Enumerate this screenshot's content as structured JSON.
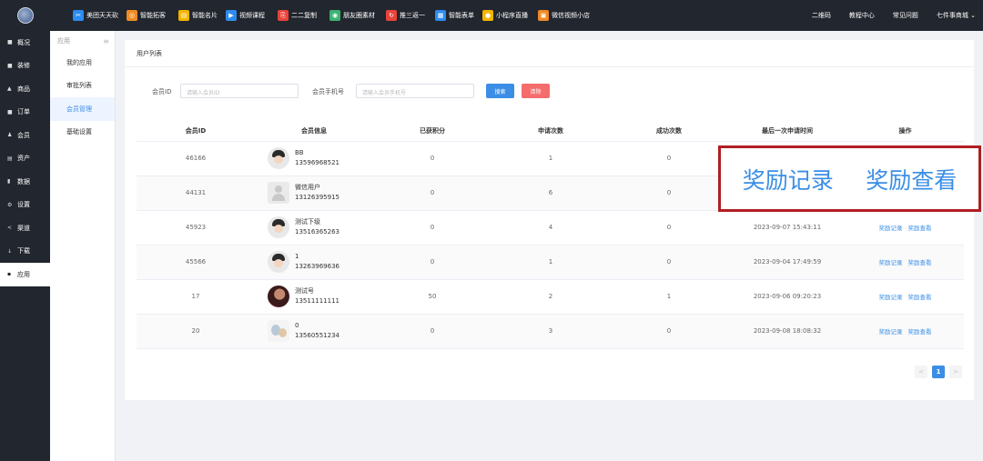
{
  "topnav": {
    "items": [
      {
        "label": "美团天天砍",
        "color": "#2d8cf0",
        "icon": "scissors-icon",
        "glyph": "✂"
      },
      {
        "label": "智能拓客",
        "color": "#f08a24",
        "icon": "target-icon",
        "glyph": "◎"
      },
      {
        "label": "智能名片",
        "color": "#f5b400",
        "icon": "card-icon",
        "glyph": "▤"
      },
      {
        "label": "视频课程",
        "color": "#2d8cf0",
        "icon": "video-icon",
        "glyph": "▶"
      },
      {
        "label": "二二复制",
        "color": "#e8433a",
        "icon": "copy-icon",
        "glyph": "⎘"
      },
      {
        "label": "朋友圈素材",
        "color": "#3cb371",
        "icon": "moments-icon",
        "glyph": "◉"
      },
      {
        "label": "推三返一",
        "color": "#e8433a",
        "icon": "share-icon",
        "glyph": "↻"
      },
      {
        "label": "智能表单",
        "color": "#2d8cf0",
        "icon": "form-icon",
        "glyph": "▦"
      },
      {
        "label": "小程序直播",
        "color": "#f5b400",
        "icon": "live-icon",
        "glyph": "●"
      },
      {
        "label": "微信视频小店",
        "color": "#f08a24",
        "icon": "shop-icon",
        "glyph": "▣"
      }
    ],
    "right": [
      "二维码",
      "教程中心",
      "常见问题",
      "七件事商城 ⌄"
    ]
  },
  "leftnav": [
    {
      "label": "概况",
      "glyph": "■"
    },
    {
      "label": "装修",
      "glyph": "■"
    },
    {
      "label": "商品",
      "glyph": "▲"
    },
    {
      "label": "订单",
      "glyph": "■"
    },
    {
      "label": "会员",
      "glyph": "♟"
    },
    {
      "label": "资产",
      "glyph": "▤"
    },
    {
      "label": "数据",
      "glyph": "▮"
    },
    {
      "label": "设置",
      "glyph": "⚙"
    },
    {
      "label": "渠道",
      "glyph": "<"
    },
    {
      "label": "下载",
      "glyph": "↓"
    },
    {
      "label": "应用",
      "glyph": "▪"
    }
  ],
  "subnav": {
    "header": "应用",
    "items": [
      "我的应用",
      "审批列表",
      "会员管理",
      "基础设置"
    ]
  },
  "panel": {
    "title": "用户列表"
  },
  "filters": {
    "member_id_label": "会员ID",
    "member_id_placeholder": "请输入会员ID",
    "phone_label": "会员手机号",
    "phone_placeholder": "请输入会员手机号",
    "search_label": "搜索",
    "clear_label": "清除"
  },
  "table": {
    "headers": [
      "会员ID",
      "会员信息",
      "已获积分",
      "申请次数",
      "成功次数",
      "最后一次申请时间",
      "操作"
    ],
    "rows": [
      {
        "id": "46166",
        "name": "BB",
        "phone": "13596968521",
        "points": "0",
        "applies": "1",
        "success": "0",
        "last": "",
        "avatar": "face"
      },
      {
        "id": "44131",
        "name": "微信用户",
        "phone": "13126395915",
        "points": "0",
        "applies": "6",
        "success": "0",
        "last": "",
        "avatar": "default"
      },
      {
        "id": "45923",
        "name": "测试下级",
        "phone": "13516365263",
        "points": "0",
        "applies": "4",
        "success": "0",
        "last": "2023-09-07 15:43:11",
        "avatar": "face"
      },
      {
        "id": "45566",
        "name": "1",
        "phone": "13263969636",
        "points": "0",
        "applies": "1",
        "success": "0",
        "last": "2023-09-04 17:49:59",
        "avatar": "face"
      },
      {
        "id": "17",
        "name": "测试号",
        "phone": "13511111111",
        "points": "50",
        "applies": "2",
        "success": "1",
        "last": "2023-09-06 09:20:23",
        "avatar": "photo"
      },
      {
        "id": "20",
        "name": "0",
        "phone": "13560551234",
        "points": "0",
        "applies": "3",
        "success": "0",
        "last": "2023-09-08 18:08:32",
        "avatar": "cartoon"
      }
    ],
    "action_record": "奖励记录",
    "action_view": "奖励查看"
  },
  "pager": {
    "prev": "<",
    "current": "1",
    "next": ">"
  },
  "zoom": {
    "record": "奖励记录",
    "view": "奖励查看"
  }
}
